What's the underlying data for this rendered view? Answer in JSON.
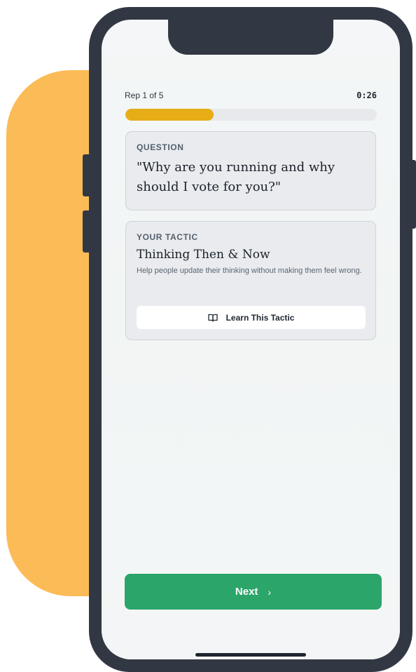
{
  "colors": {
    "backdrop": "#fbbb57",
    "phone_frame": "#323843",
    "progress_fill": "#e6ad16",
    "next_button": "#2ba56a"
  },
  "progress": {
    "rep_label": "Rep 1 of 5",
    "timer": "0:26",
    "fraction": 0.35
  },
  "question": {
    "label": "QUESTION",
    "text": "\"Why are you running and why should I vote for you?\""
  },
  "tactic": {
    "label": "YOUR TACTIC",
    "name": "Thinking Then & Now",
    "description": "Help people update their thinking without making them feel wrong.",
    "learn_button": {
      "icon": "book-open-icon",
      "label": "Learn This Tactic"
    }
  },
  "footer": {
    "next_label": "Next",
    "next_icon": "chevron-right-icon"
  }
}
